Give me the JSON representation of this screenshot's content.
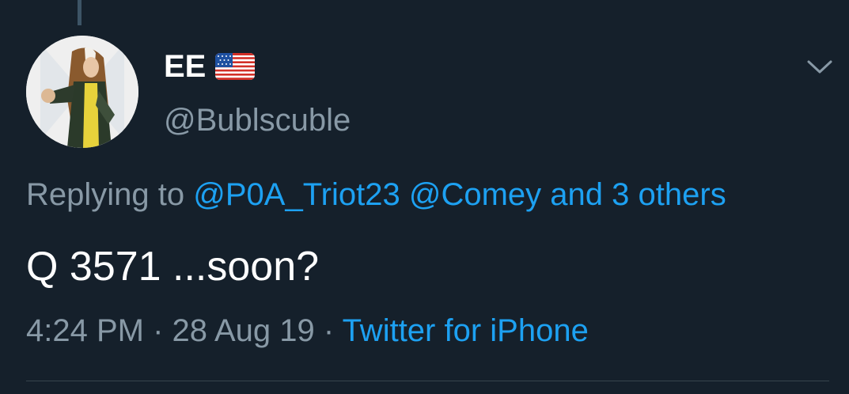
{
  "user": {
    "display_name": "EE",
    "flag_icon": "us-flag-icon",
    "handle": "@Bublscuble",
    "avatar_icon": "profile-avatar"
  },
  "reply": {
    "prefix": "Replying to",
    "mention_1": "@P0A_Triot23",
    "mention_2": "@Comey",
    "and": "and",
    "others": "3 others"
  },
  "tweet": {
    "text": "Q 3571 ...soon?"
  },
  "meta": {
    "time": "4:24 PM",
    "sep1": "·",
    "date": "28 Aug 19",
    "sep2": "·",
    "source": "Twitter for iPhone"
  },
  "menu": {
    "caret_icon": "chevron-down-icon"
  },
  "colors": {
    "background": "#15202b",
    "text": "#ffffff",
    "muted": "#8899a6",
    "link": "#1da1f2"
  }
}
